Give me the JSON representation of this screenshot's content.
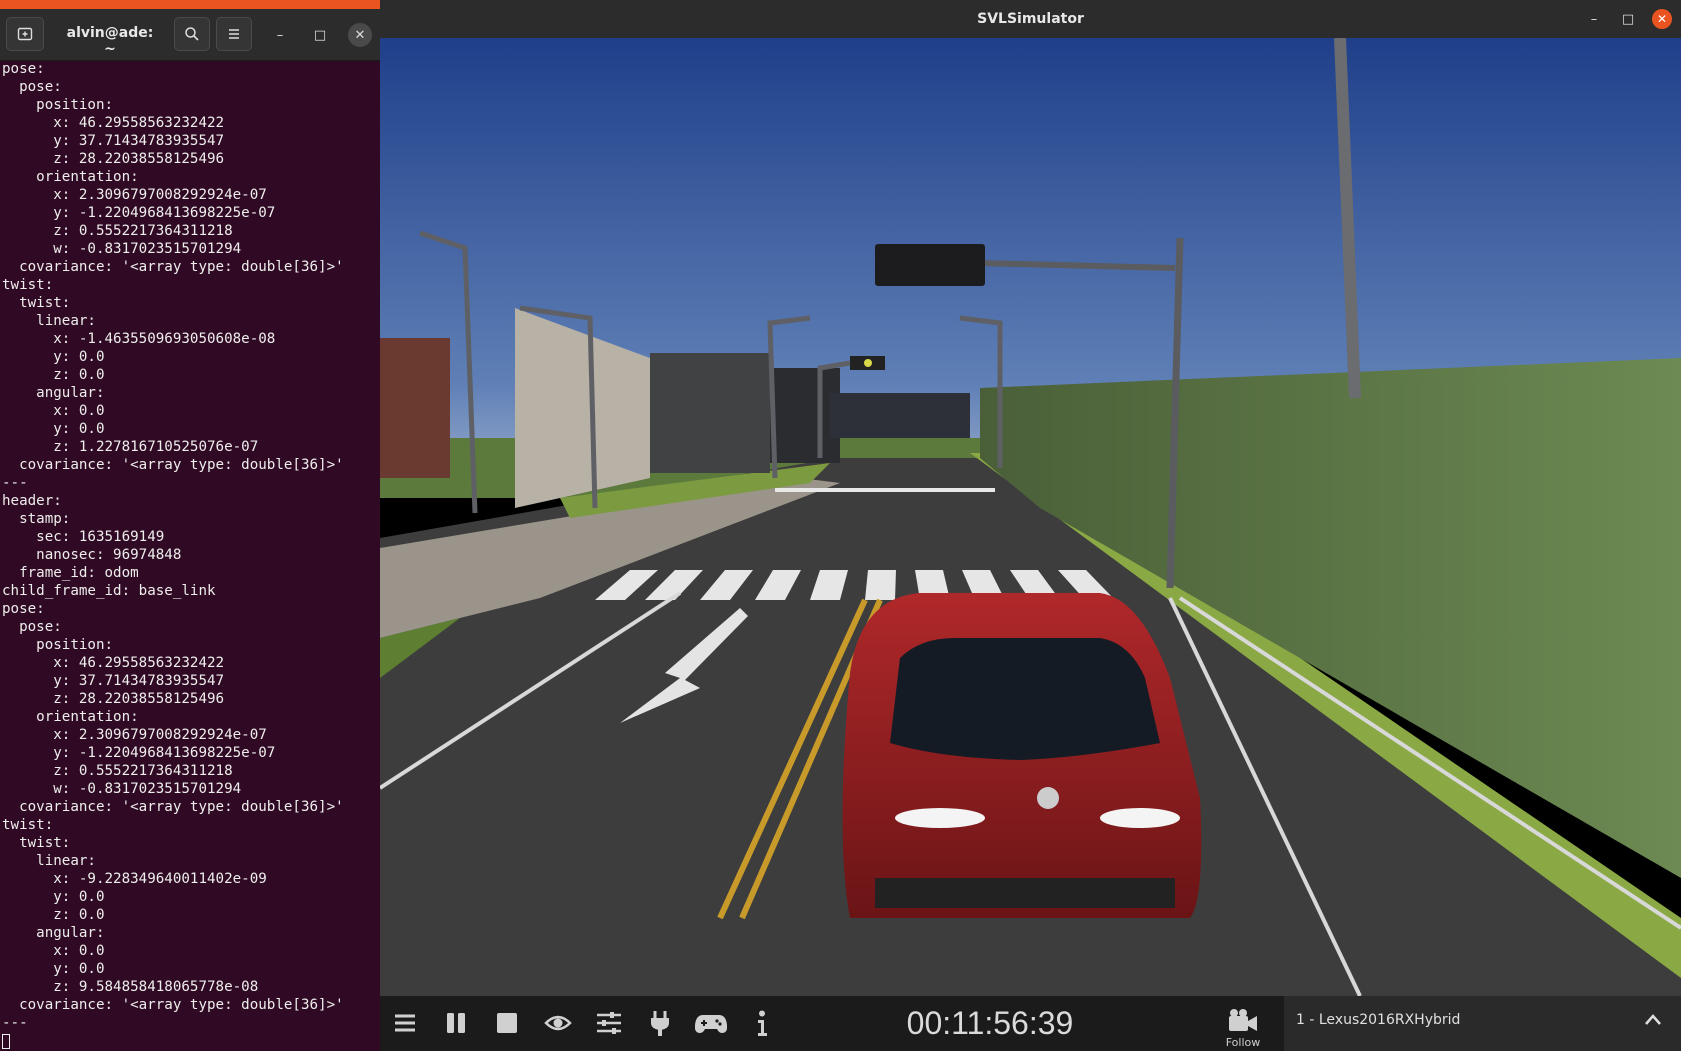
{
  "terminal": {
    "title": "alvin@ade: ~",
    "lines": [
      "pose:",
      "  pose:",
      "    position:",
      "      x: 46.29558563232422",
      "      y: 37.71434783935547",
      "      z: 28.22038558125496",
      "    orientation:",
      "      x: 2.3096797008292924e-07",
      "      y: -1.2204968413698225e-07",
      "      z: 0.5552217364311218",
      "      w: -0.8317023515701294",
      "  covariance: '<array type: double[36]>'",
      "twist:",
      "  twist:",
      "    linear:",
      "      x: -1.4635509693050608e-08",
      "      y: 0.0",
      "      z: 0.0",
      "    angular:",
      "      x: 0.0",
      "      y: 0.0",
      "      z: 1.227816710525076e-07",
      "  covariance: '<array type: double[36]>'",
      "---",
      "header:",
      "  stamp:",
      "    sec: 1635169149",
      "    nanosec: 96974848",
      "  frame_id: odom",
      "child_frame_id: base_link",
      "pose:",
      "  pose:",
      "    position:",
      "      x: 46.29558563232422",
      "      y: 37.71434783935547",
      "      z: 28.22038558125496",
      "    orientation:",
      "      x: 2.3096797008292924e-07",
      "      y: -1.2204968413698225e-07",
      "      z: 0.5552217364311218",
      "      w: -0.8317023515701294",
      "  covariance: '<array type: double[36]>'",
      "twist:",
      "  twist:",
      "    linear:",
      "      x: -9.228349640011402e-09",
      "      y: 0.0",
      "      z: 0.0",
      "    angular:",
      "      x: 0.0",
      "      y: 0.0",
      "      z: 9.584858418065778e-08",
      "  covariance: '<array type: double[36]>'",
      "---"
    ],
    "buttons": {
      "new_tab_icon": "new-tab-icon",
      "search_icon": "search-icon",
      "menu_icon": "hamburger-menu-icon",
      "minimize": "–",
      "maximize": "□",
      "close": "✕"
    }
  },
  "simulator": {
    "title": "SVLSimulator",
    "window_controls": {
      "minimize": "–",
      "maximize": "□",
      "close": "✕"
    },
    "toolbar": {
      "icons": [
        "menu-icon",
        "pause-icon",
        "stop-icon",
        "eye-icon",
        "sliders-icon",
        "plug-icon",
        "gamepad-icon",
        "info-icon"
      ],
      "clock": "00:11:56:39",
      "camera_mode": "Follow",
      "vehicle": "1 - Lexus2016RXHybrid"
    },
    "colors": {
      "accent": "#e95420",
      "car": "#8e1d1f",
      "sky_top": "#1f3f8a",
      "sky_bottom": "#8aa4c8",
      "fence": "#5a7044"
    }
  }
}
